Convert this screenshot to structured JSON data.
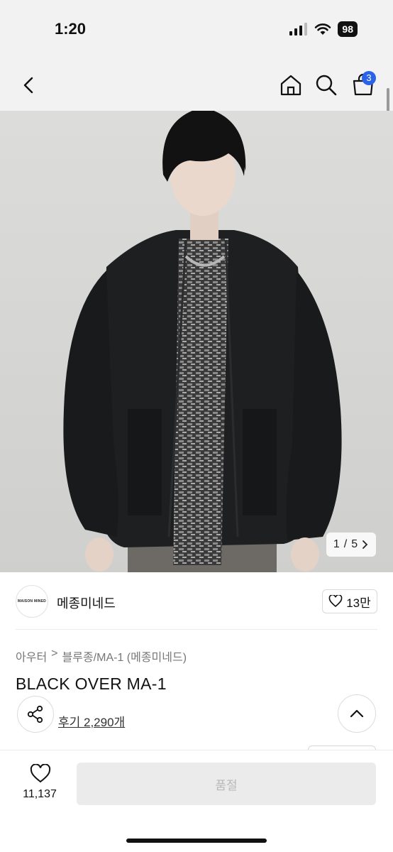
{
  "status_bar": {
    "time": "1:20",
    "battery": "98",
    "icons": [
      "signal-icon",
      "wifi-icon",
      "battery-icon"
    ]
  },
  "nav": {
    "cart_badge": "3",
    "icons": [
      "back-arrow-icon",
      "home-icon",
      "search-icon",
      "cart-icon"
    ],
    "badge_color": "#2a63e8"
  },
  "gallery": {
    "current": "1",
    "separator": "/",
    "total": "5"
  },
  "brand": {
    "logo_text": "MAISON MINED",
    "name": "메종미네드",
    "likes": "13만"
  },
  "breadcrumb": {
    "category": "아우터",
    "arrow": ">",
    "subcategory": "블루종/MA-1 (메종미네드)"
  },
  "product": {
    "title": "BLACK OVER MA-1",
    "review_text": "후기 2,290개"
  },
  "bottom_bar": {
    "wish_count": "11,137",
    "buy_label": "품절"
  }
}
